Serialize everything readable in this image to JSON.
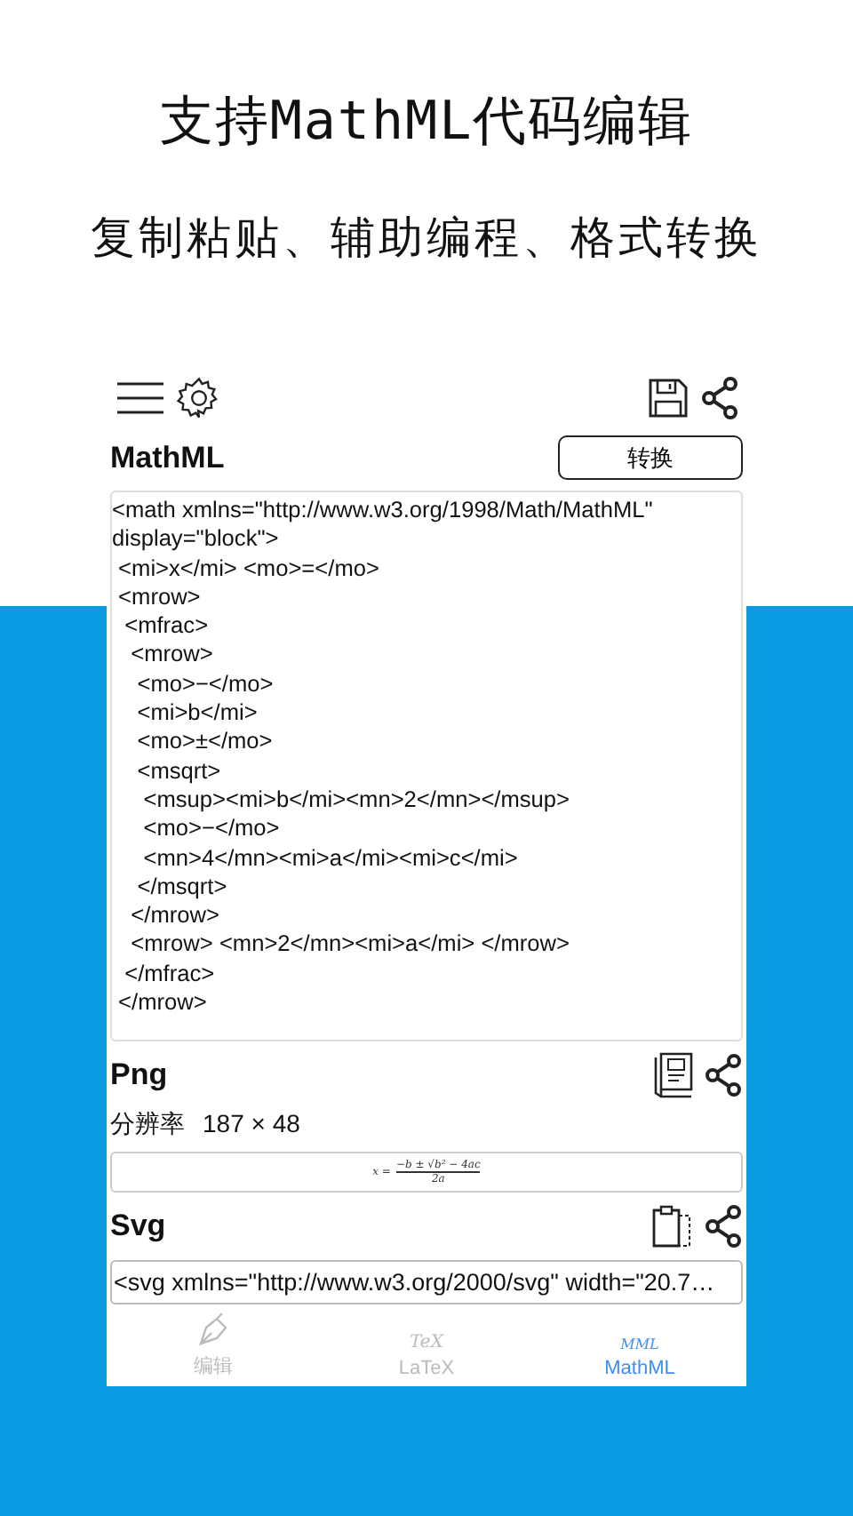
{
  "header": {
    "title": "支持MathML代码编辑",
    "subtitle": "复制粘贴、辅助编程、格式转换"
  },
  "editor": {
    "label": "MathML",
    "convert_button": "转换",
    "code_lines": [
      "<math xmlns=\"http://www.w3.org/1998/Math/MathML\"",
      "display=\"block\">",
      " <mi>x</mi> <mo>=</mo>",
      " <mrow>",
      "  <mfrac>",
      "   <mrow>",
      "    <mo>−</mo>",
      "    <mi>b</mi>",
      "    <mo>±</mo>",
      "    <msqrt>",
      "     <msup><mi>b</mi><mn>2</mn></msup>",
      "     <mo>−</mo>",
      "     <mn>4</mn><mi>a</mi><mi>c</mi>",
      "    </msqrt>",
      "   </mrow>",
      "   <mrow> <mn>2</mn><mi>a</mi> </mrow>",
      "  </mfrac>",
      " </mrow>"
    ]
  },
  "png": {
    "label": "Png",
    "resolution_label": "分辨率",
    "resolution": "187 × 48",
    "formula": {
      "lhs": "x =",
      "numerator": "−b ± √b² − 4ac",
      "denominator": "2a"
    }
  },
  "svg": {
    "label": "Svg",
    "value": "<svg xmlns=\"http://www.w3.org/2000/svg\" width=\"20.7…"
  },
  "tabs": [
    {
      "label": "编辑",
      "icon": {
        "kind": "pen"
      },
      "selected": false
    },
    {
      "label": "LaTeX",
      "icon": {
        "kind": "text",
        "text": "TeX"
      },
      "selected": false
    },
    {
      "label": "MathML",
      "icon": {
        "kind": "text",
        "text": "MML"
      },
      "selected": true
    }
  ]
}
